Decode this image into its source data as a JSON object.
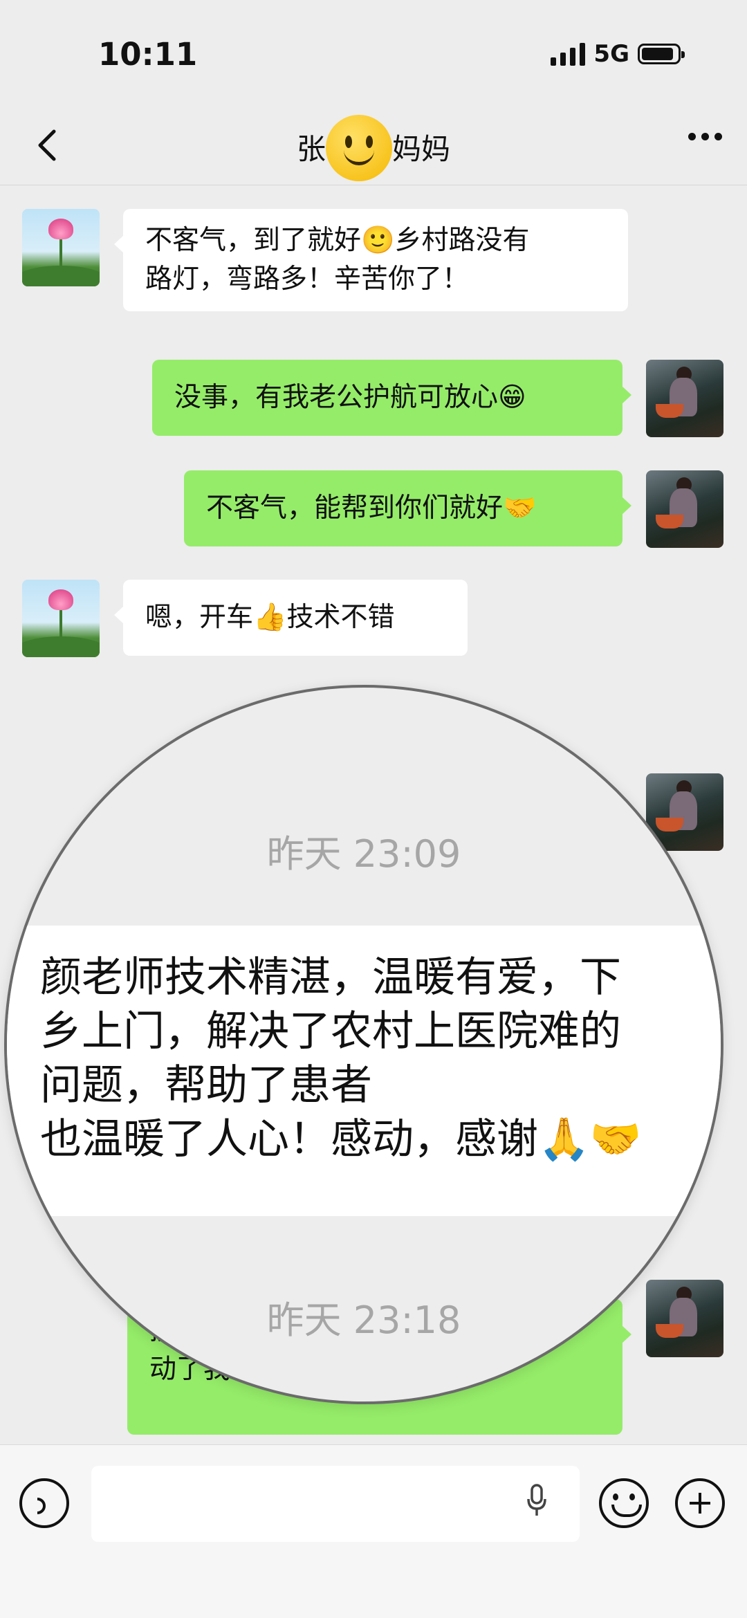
{
  "status_bar": {
    "time": "10:11",
    "network": "5G",
    "battery_level": 0.9
  },
  "nav": {
    "title_left": "张",
    "title_right": "妈妈",
    "title_emoji": "smiley-face-icon",
    "back_icon": "chevron-left-icon",
    "more_icon": "more-dots-icon"
  },
  "messages": [
    {
      "side": "left",
      "avatar": "lotus",
      "text": "不客气，到了就好🙂乡村路没有\n路灯，弯路多！辛苦你了！"
    },
    {
      "side": "right",
      "avatar": "farm",
      "text": "没事，有我老公护航可放心😁"
    },
    {
      "side": "right",
      "avatar": "farm",
      "text": "不客气，能帮到你们就好🤝"
    },
    {
      "side": "left",
      "avatar": "lotus",
      "text": "嗯，开车👍技术不错"
    },
    {
      "side": "right",
      "avatar": "farm",
      "text": "接……感\n动了我🤝"
    }
  ],
  "magnifier": {
    "time_1": "昨天 23:09",
    "message": "颜老师技术精湛，温暖有爱，下\n乡上门，解决了农村上医院难的\n问题，帮助了患者\n也温暖了人心！感动，感谢🙏🤝",
    "time_2": "昨天 23:18"
  },
  "input_bar": {
    "placeholder": "",
    "voice_icon": "voice-icon",
    "mic_icon": "mic-icon",
    "emoji_icon": "emoji-icon",
    "plus_icon": "plus-icon"
  },
  "colors": {
    "background": "#ededed",
    "bubble_self": "#95ec69",
    "bubble_other": "#ffffff"
  }
}
